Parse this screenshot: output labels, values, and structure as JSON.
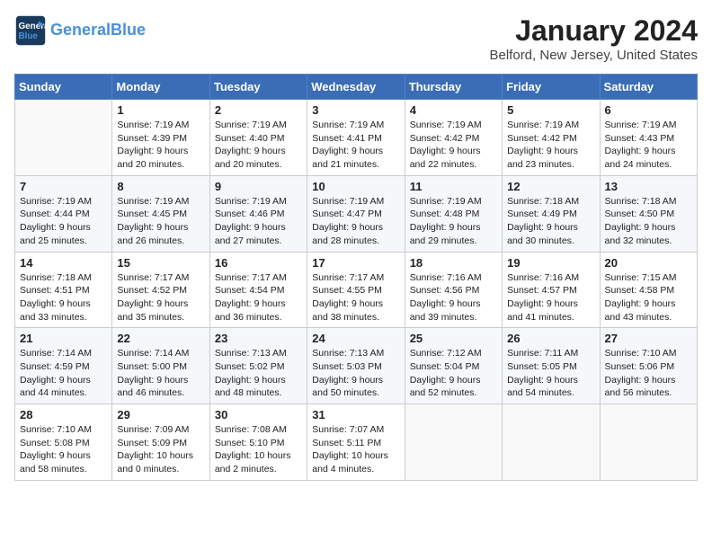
{
  "logo": {
    "line1": "General",
    "line2": "Blue"
  },
  "title": "January 2024",
  "subtitle": "Belford, New Jersey, United States",
  "days_of_week": [
    "Sunday",
    "Monday",
    "Tuesday",
    "Wednesday",
    "Thursday",
    "Friday",
    "Saturday"
  ],
  "weeks": [
    [
      {
        "day": "",
        "info": ""
      },
      {
        "day": "1",
        "info": "Sunrise: 7:19 AM\nSunset: 4:39 PM\nDaylight: 9 hours\nand 20 minutes."
      },
      {
        "day": "2",
        "info": "Sunrise: 7:19 AM\nSunset: 4:40 PM\nDaylight: 9 hours\nand 20 minutes."
      },
      {
        "day": "3",
        "info": "Sunrise: 7:19 AM\nSunset: 4:41 PM\nDaylight: 9 hours\nand 21 minutes."
      },
      {
        "day": "4",
        "info": "Sunrise: 7:19 AM\nSunset: 4:42 PM\nDaylight: 9 hours\nand 22 minutes."
      },
      {
        "day": "5",
        "info": "Sunrise: 7:19 AM\nSunset: 4:42 PM\nDaylight: 9 hours\nand 23 minutes."
      },
      {
        "day": "6",
        "info": "Sunrise: 7:19 AM\nSunset: 4:43 PM\nDaylight: 9 hours\nand 24 minutes."
      }
    ],
    [
      {
        "day": "7",
        "info": "Sunrise: 7:19 AM\nSunset: 4:44 PM\nDaylight: 9 hours\nand 25 minutes."
      },
      {
        "day": "8",
        "info": "Sunrise: 7:19 AM\nSunset: 4:45 PM\nDaylight: 9 hours\nand 26 minutes."
      },
      {
        "day": "9",
        "info": "Sunrise: 7:19 AM\nSunset: 4:46 PM\nDaylight: 9 hours\nand 27 minutes."
      },
      {
        "day": "10",
        "info": "Sunrise: 7:19 AM\nSunset: 4:47 PM\nDaylight: 9 hours\nand 28 minutes."
      },
      {
        "day": "11",
        "info": "Sunrise: 7:19 AM\nSunset: 4:48 PM\nDaylight: 9 hours\nand 29 minutes."
      },
      {
        "day": "12",
        "info": "Sunrise: 7:18 AM\nSunset: 4:49 PM\nDaylight: 9 hours\nand 30 minutes."
      },
      {
        "day": "13",
        "info": "Sunrise: 7:18 AM\nSunset: 4:50 PM\nDaylight: 9 hours\nand 32 minutes."
      }
    ],
    [
      {
        "day": "14",
        "info": "Sunrise: 7:18 AM\nSunset: 4:51 PM\nDaylight: 9 hours\nand 33 minutes."
      },
      {
        "day": "15",
        "info": "Sunrise: 7:17 AM\nSunset: 4:52 PM\nDaylight: 9 hours\nand 35 minutes."
      },
      {
        "day": "16",
        "info": "Sunrise: 7:17 AM\nSunset: 4:54 PM\nDaylight: 9 hours\nand 36 minutes."
      },
      {
        "day": "17",
        "info": "Sunrise: 7:17 AM\nSunset: 4:55 PM\nDaylight: 9 hours\nand 38 minutes."
      },
      {
        "day": "18",
        "info": "Sunrise: 7:16 AM\nSunset: 4:56 PM\nDaylight: 9 hours\nand 39 minutes."
      },
      {
        "day": "19",
        "info": "Sunrise: 7:16 AM\nSunset: 4:57 PM\nDaylight: 9 hours\nand 41 minutes."
      },
      {
        "day": "20",
        "info": "Sunrise: 7:15 AM\nSunset: 4:58 PM\nDaylight: 9 hours\nand 43 minutes."
      }
    ],
    [
      {
        "day": "21",
        "info": "Sunrise: 7:14 AM\nSunset: 4:59 PM\nDaylight: 9 hours\nand 44 minutes."
      },
      {
        "day": "22",
        "info": "Sunrise: 7:14 AM\nSunset: 5:00 PM\nDaylight: 9 hours\nand 46 minutes."
      },
      {
        "day": "23",
        "info": "Sunrise: 7:13 AM\nSunset: 5:02 PM\nDaylight: 9 hours\nand 48 minutes."
      },
      {
        "day": "24",
        "info": "Sunrise: 7:13 AM\nSunset: 5:03 PM\nDaylight: 9 hours\nand 50 minutes."
      },
      {
        "day": "25",
        "info": "Sunrise: 7:12 AM\nSunset: 5:04 PM\nDaylight: 9 hours\nand 52 minutes."
      },
      {
        "day": "26",
        "info": "Sunrise: 7:11 AM\nSunset: 5:05 PM\nDaylight: 9 hours\nand 54 minutes."
      },
      {
        "day": "27",
        "info": "Sunrise: 7:10 AM\nSunset: 5:06 PM\nDaylight: 9 hours\nand 56 minutes."
      }
    ],
    [
      {
        "day": "28",
        "info": "Sunrise: 7:10 AM\nSunset: 5:08 PM\nDaylight: 9 hours\nand 58 minutes."
      },
      {
        "day": "29",
        "info": "Sunrise: 7:09 AM\nSunset: 5:09 PM\nDaylight: 10 hours\nand 0 minutes."
      },
      {
        "day": "30",
        "info": "Sunrise: 7:08 AM\nSunset: 5:10 PM\nDaylight: 10 hours\nand 2 minutes."
      },
      {
        "day": "31",
        "info": "Sunrise: 7:07 AM\nSunset: 5:11 PM\nDaylight: 10 hours\nand 4 minutes."
      },
      {
        "day": "",
        "info": ""
      },
      {
        "day": "",
        "info": ""
      },
      {
        "day": "",
        "info": ""
      }
    ]
  ]
}
